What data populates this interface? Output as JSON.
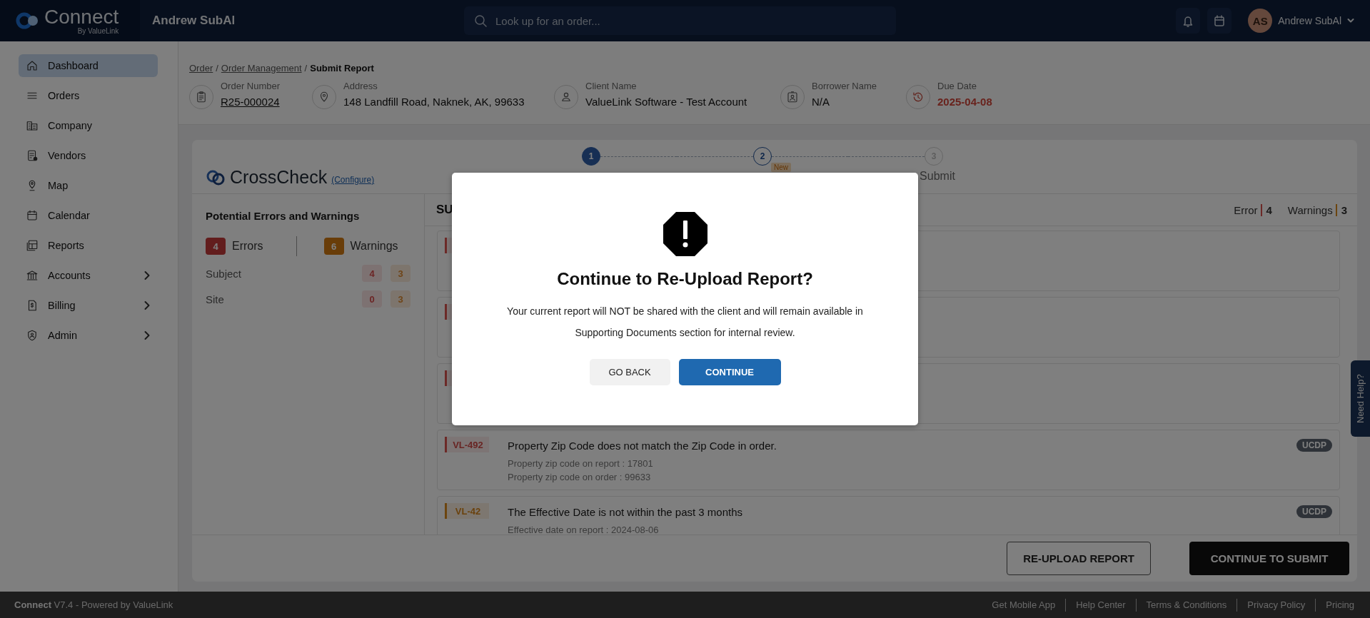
{
  "topbar": {
    "brand": "Connect",
    "brand_sub": "By ValueLink",
    "user_title": "Andrew SubAl",
    "search": {
      "placeholder": "Look up for an order..."
    },
    "user": {
      "initials": "AS",
      "name": "Andrew SubAl"
    }
  },
  "sidebar": {
    "items": [
      {
        "label": "Dashboard",
        "selected": true,
        "expandable": false
      },
      {
        "label": "Orders",
        "selected": false,
        "expandable": false
      },
      {
        "label": "Company",
        "selected": false,
        "expandable": false
      },
      {
        "label": "Vendors",
        "selected": false,
        "expandable": false
      },
      {
        "label": "Map",
        "selected": false,
        "expandable": false
      },
      {
        "label": "Calendar",
        "selected": false,
        "expandable": false
      },
      {
        "label": "Reports",
        "selected": false,
        "expandable": false
      },
      {
        "label": "Accounts",
        "selected": false,
        "expandable": true
      },
      {
        "label": "Billing",
        "selected": false,
        "expandable": true
      },
      {
        "label": "Admin",
        "selected": false,
        "expandable": true
      }
    ]
  },
  "breadcrumb": [
    {
      "label": "Order",
      "kind": "link"
    },
    {
      "label": "/",
      "kind": "separator"
    },
    {
      "label": "Order Management",
      "kind": "link"
    },
    {
      "label": "/",
      "kind": "separator"
    },
    {
      "label": "Submit Report",
      "kind": "current"
    }
  ],
  "order_info": [
    {
      "label": "Order Number",
      "value": "R25-000024",
      "kind": "link"
    },
    {
      "label": "Address",
      "value": "148 Landfill Road, Naknek, AK, 99633",
      "kind": "text"
    },
    {
      "label": "Client Name",
      "value": "ValueLink Software - Test Account",
      "kind": "text"
    },
    {
      "label": "Borrower Name",
      "value": "N/A",
      "kind": "text"
    },
    {
      "label": "Due Date",
      "value": "2025-04-08",
      "kind": "alert"
    }
  ],
  "crosscheck": {
    "title": "CrossCheck",
    "configure": "(Configure)",
    "steps": [
      {
        "number": "1",
        "selected": true,
        "reached": true
      },
      {
        "number": "2",
        "selected": false,
        "reached": true,
        "tag": "New"
      },
      {
        "number": "3",
        "selected": false,
        "reached": false,
        "label": "Submit"
      }
    ],
    "summary": {
      "title": "Potential Errors and Warnings",
      "errors": {
        "count": "4",
        "label": "Errors"
      },
      "warnings": {
        "count": "6",
        "label": "Warnings"
      },
      "categories": [
        {
          "name": "Subject",
          "errors": "4",
          "warnings": "3"
        },
        {
          "name": "Site",
          "errors": "0",
          "warnings": "3"
        }
      ]
    },
    "list": {
      "title": "SU",
      "error_label": "Error",
      "error_count": "4",
      "warning_label": "Warnings",
      "warning_count": "3",
      "items": [
        {
          "kind": "error"
        },
        {
          "kind": "error"
        },
        {
          "kind": "error"
        },
        {
          "kind": "error",
          "code": "VL-492",
          "title": "Property Zip Code does not match the Zip Code in order.",
          "details": [
            "Property zip code on report : 17801",
            "Property zip code on order : 99633"
          ],
          "badge": "UCDP"
        },
        {
          "kind": "warning",
          "code": "VL-42",
          "title": "The Effective Date is not within the past 3 months",
          "details": [
            "Effective date on report : 2024-08-06"
          ],
          "badge": "UCDP"
        }
      ]
    },
    "actions": [
      {
        "label": "RE-UPLOAD REPORT",
        "kind": "outline"
      },
      {
        "label": "CONTINUE TO SUBMIT",
        "kind": "primary"
      }
    ]
  },
  "help_tab": "Need Help?",
  "footer": {
    "text": "**Connect** V7.4 - Powered by ValueLink",
    "links": [
      "Get Mobile App",
      "Help Center",
      "Terms & Conditions",
      "Privacy Policy",
      "Pricing"
    ]
  },
  "modal": {
    "title": "Continue to Re-Upload Report?",
    "message": "Your current report will NOT be shared with the client and will remain available in Supporting Documents section for internal review.",
    "buttons": [
      {
        "label": "GO BACK",
        "kind": "secondary"
      },
      {
        "label": "CONTINUE",
        "kind": "primary"
      }
    ]
  }
}
